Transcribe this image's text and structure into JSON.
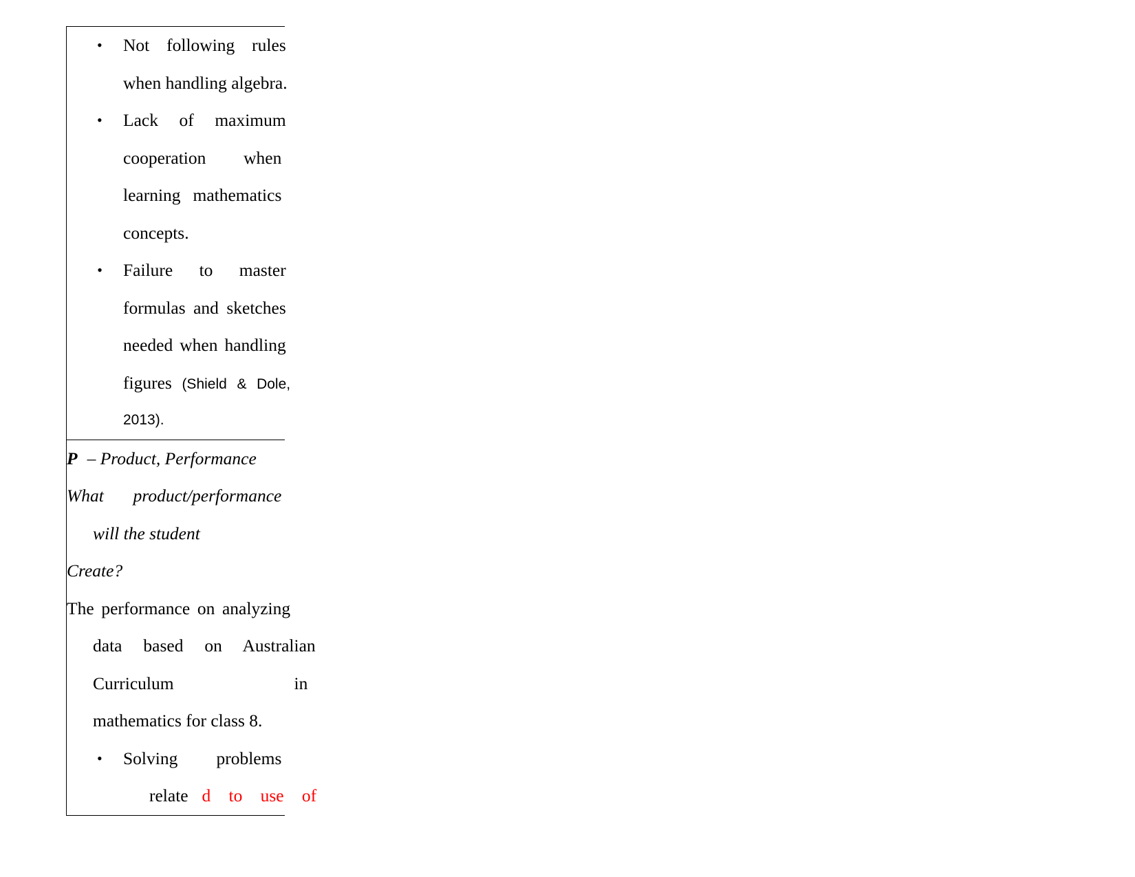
{
  "document": {
    "table": {
      "cells": [
        {
          "id": "difficulties-cell",
          "type": "bullet-list",
          "bullets": [
            {
              "marker": "•",
              "marker_style": "disc",
              "lines": [
                [
                  "Not",
                  "following",
                  "rules"
                ],
                [
                  "when handling algebra."
                ]
              ],
              "text": "Not following rules when handling algebra."
            },
            {
              "marker": "•",
              "marker_style": "disc",
              "lines": [
                [
                  "Lack",
                  "of",
                  "maximum"
                ],
                [
                  "cooperation",
                  "when"
                ],
                [
                  "learning",
                  "mathematics"
                ],
                [
                  "concepts."
                ]
              ],
              "text": "Lack of maximum cooperation when learning mathematics concepts."
            },
            {
              "marker": "•",
              "marker_style": "disc-italic",
              "lines": [
                [
                  "Failure",
                  "to",
                  "master"
                ],
                [
                  "formulas",
                  "and",
                  "sketches"
                ],
                [
                  "needed",
                  "when",
                  "handling"
                ]
              ],
              "text": "Failure to master formulas and sketches needed when handling figures",
              "citation_line_prefix": "figures",
              "citation_parts": [
                "(Shield",
                "&",
                "Dole,"
              ],
              "citation_tail": "2013).",
              "citation": "(Shield & Dole, 2013)."
            }
          ]
        },
        {
          "id": "product-performance-cell",
          "type": "mixed",
          "heading_letter": "P",
          "heading_rest": " – Product, Performance",
          "prompt_line_1": [
            "What",
            "product/performance"
          ],
          "prompt_line_2": "will the student",
          "prompt_line_3": "Create?",
          "body_lines": [
            [
              "The",
              "performance",
              "on",
              "analyzing"
            ],
            [
              "data",
              "based",
              "on",
              "Australian"
            ],
            [
              "Curriculum",
              "in"
            ],
            [
              "mathematics for class 8."
            ]
          ],
          "body_text": "The performance on analyzing data based on Australian Curriculum in mathematics for class 8.",
          "bullet": {
            "marker": "•",
            "line_1": [
              "Solving",
              "problems"
            ],
            "line_2_black": "relate",
            "line_2_red": [
              "d",
              "to",
              "use",
              "of"
            ],
            "text": "Solving problems related to use of"
          }
        }
      ]
    },
    "colors": {
      "text": "#000000",
      "highlight_red": "#FF0000",
      "border": "#000000",
      "page_background": "#FFFFFF"
    }
  }
}
